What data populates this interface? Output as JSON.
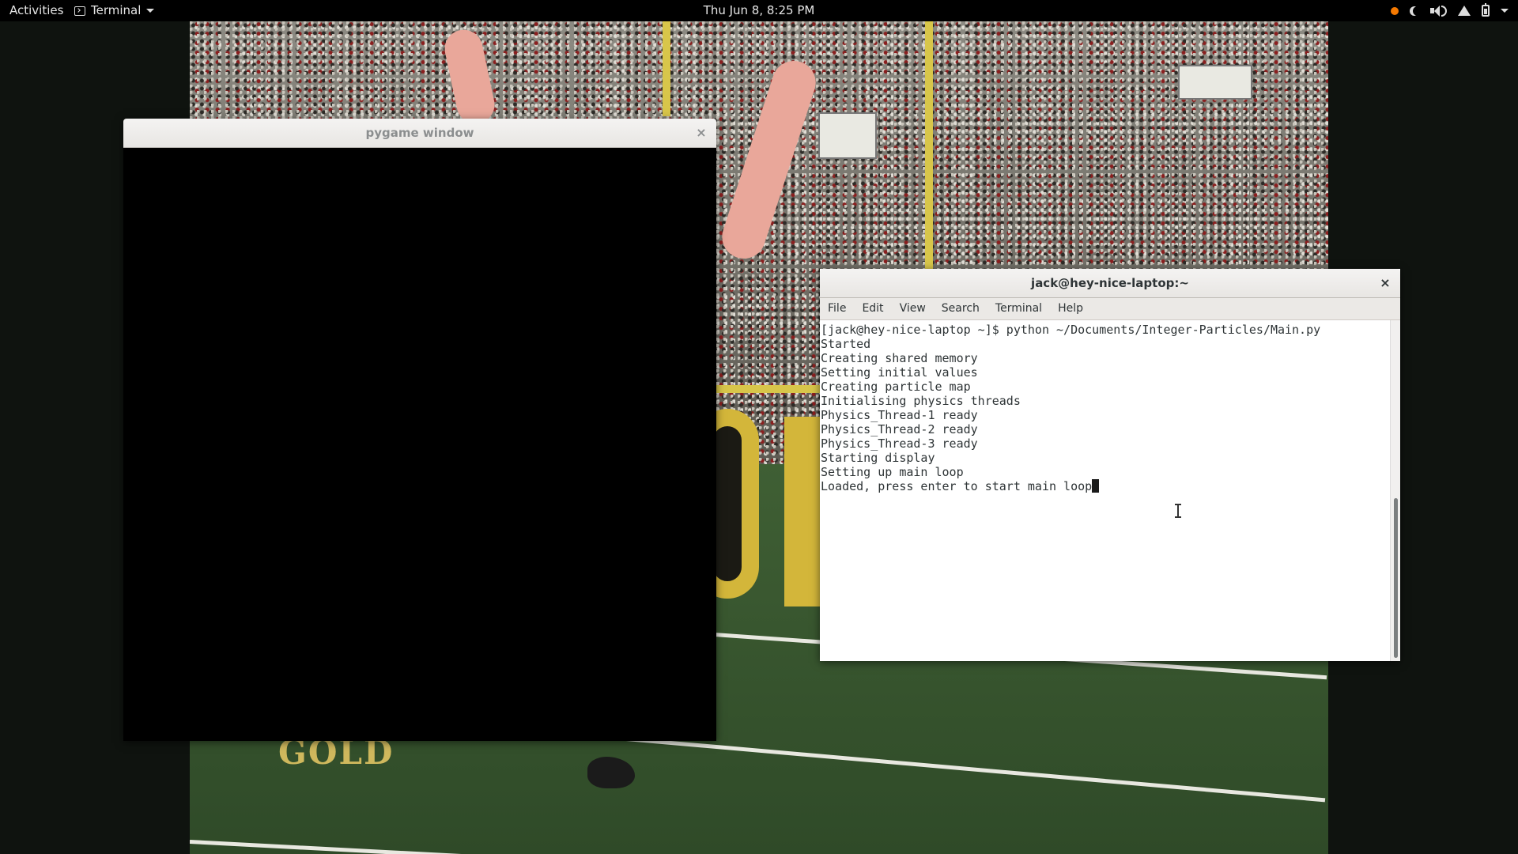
{
  "topbar": {
    "activities": "Activities",
    "app_menu": "Terminal",
    "clock": "Thu Jun  8,  8:25 PM",
    "tray_icons": [
      "notification-dot",
      "night-light-icon",
      "volume-icon",
      "wifi-icon",
      "battery-icon",
      "system-menu-caret"
    ]
  },
  "wallpaper": {
    "sign_text": "GOLD"
  },
  "pygame_window": {
    "title": "pygame window",
    "close_glyph": "×"
  },
  "terminal_window": {
    "title": "jack@hey-nice-laptop:~",
    "close_glyph": "×",
    "menus": [
      "File",
      "Edit",
      "View",
      "Search",
      "Terminal",
      "Help"
    ],
    "lines": [
      "[jack@hey-nice-laptop ~]$ python ~/Documents/Integer-Particles/Main.py",
      "Started",
      "Creating shared memory",
      "Setting initial values",
      "Creating particle map",
      "Initialising physics threads",
      "Physics_Thread-1 ready",
      "Physics_Thread-2 ready",
      "Physics_Thread-3 ready",
      "Starting display",
      "Setting up main loop",
      "Loaded, press enter to start main loop"
    ]
  },
  "colors": {
    "topbar_bg": "#000000",
    "accent_orange": "#f57900",
    "terminal_text": "#2e3436",
    "pygame_canvas": "#000000"
  }
}
